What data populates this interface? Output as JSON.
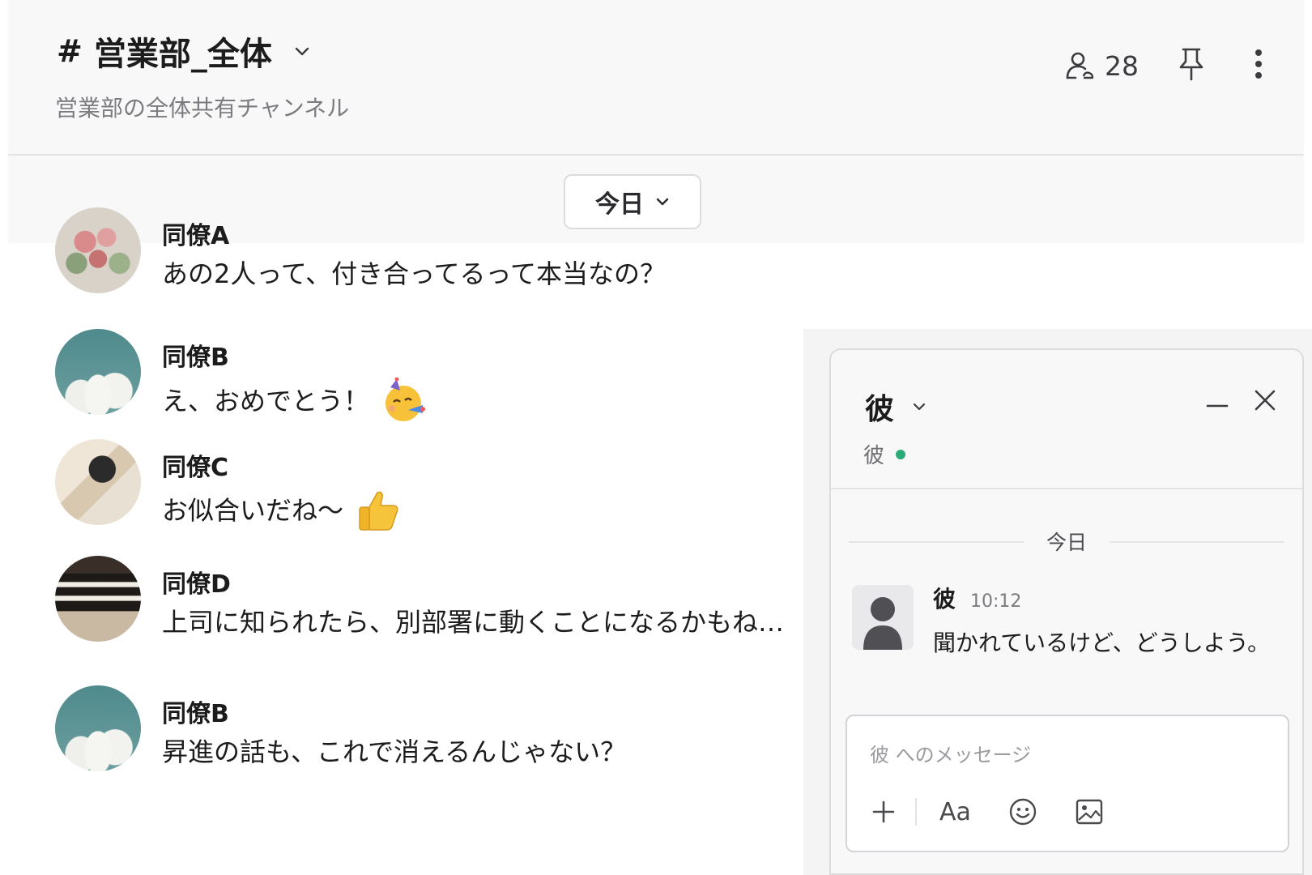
{
  "channel": {
    "hash": "#",
    "name": "営業部_全体",
    "description": "営業部の全体共有チャンネル",
    "member_count": "28"
  },
  "date_divider": {
    "label": "今日"
  },
  "messages": [
    {
      "author": "同僚A",
      "text": "あの2人って、付き合ってるって本当なの？",
      "emoji": null,
      "avatar": "flowers"
    },
    {
      "author": "同僚B",
      "text": "え、おめでとう！",
      "emoji": "party-face",
      "avatar": "clouds"
    },
    {
      "author": "同僚C",
      "text": "お似合いだね〜",
      "emoji": "thumbs-up",
      "avatar": "camera"
    },
    {
      "author": "同僚D",
      "text": "上司に知られたら、別部署に動くことになるかもね…",
      "emoji": null,
      "avatar": "books"
    },
    {
      "author": "同僚B",
      "text": "昇進の話も、これで消えるんじゃない？",
      "emoji": null,
      "avatar": "clouds"
    }
  ],
  "dm": {
    "title": "彼",
    "status_name": "彼",
    "presence": "online",
    "date_label": "今日",
    "message": {
      "author": "彼",
      "time": "10:12",
      "text": "聞かれているけど、どうしよう。"
    },
    "composer_placeholder": "彼 へのメッセージ",
    "format_label": "Aa"
  },
  "icons": {
    "members": "people-icon",
    "pin": "pin-icon",
    "more": "more-vertical-icon",
    "minimize": "minimize-icon",
    "close": "close-icon",
    "attach": "plus-icon",
    "emoji": "smiley-icon",
    "image": "image-icon"
  },
  "colors": {
    "presence_online": "#2bac76",
    "header_bg": "#f8f8f9",
    "text": "#1d1c1d",
    "muted": "#7b7b80"
  }
}
